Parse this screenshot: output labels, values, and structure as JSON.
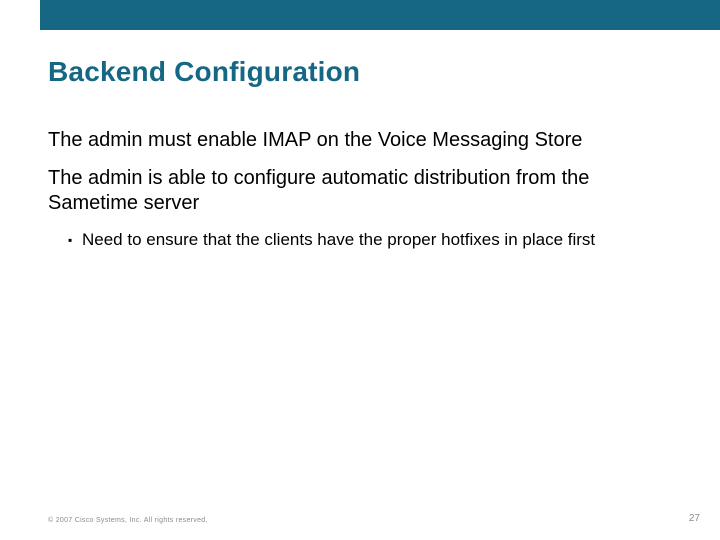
{
  "title": "Backend Configuration",
  "paragraphs": [
    "The admin must enable IMAP on the Voice Messaging Store",
    "The admin is able to configure automatic distribution from the Sametime server"
  ],
  "sub_bullets": [
    "Need to ensure that the clients have the proper hotfixes in place first"
  ],
  "footer": {
    "copyright": "© 2007 Cisco Systems, Inc. All rights reserved.",
    "page_number": "27"
  }
}
